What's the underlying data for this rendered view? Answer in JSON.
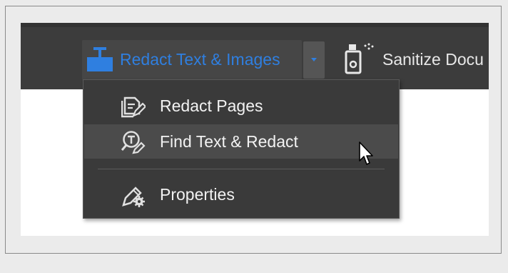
{
  "toolbar": {
    "redact_button_label": "Redact Text & Images",
    "redact_icon": "redact-icon",
    "dropdown_icon": "chevron-down-icon",
    "sanitize_button_label": "Sanitize Docu",
    "sanitize_icon": "spray-bottle-icon",
    "accent_color": "#2f7fe0"
  },
  "menu": {
    "items": [
      {
        "label": "Redact Pages",
        "icon": "redact-pages-icon",
        "hovered": false
      },
      {
        "label": "Find Text & Redact",
        "icon": "find-text-redact-icon",
        "hovered": true
      },
      {
        "label": "Properties",
        "icon": "properties-icon",
        "hovered": false
      }
    ]
  }
}
